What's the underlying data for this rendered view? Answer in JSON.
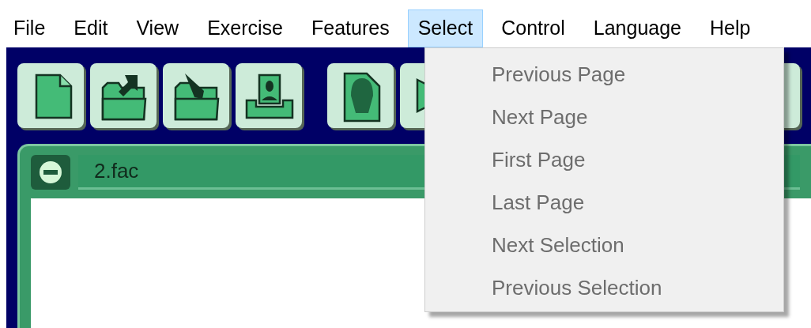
{
  "menu_bar": [
    {
      "label": "File",
      "selected": false
    },
    {
      "label": "Edit",
      "selected": false
    },
    {
      "label": "View",
      "selected": false
    },
    {
      "label": "Exercise",
      "selected": false
    },
    {
      "label": "Features",
      "selected": false
    },
    {
      "label": "Select",
      "selected": true
    },
    {
      "label": "Control",
      "selected": false
    },
    {
      "label": "Language",
      "selected": false
    },
    {
      "label": "Help",
      "selected": false
    }
  ],
  "toolbar": [
    {
      "kind": "new"
    },
    {
      "kind": "open"
    },
    {
      "kind": "import"
    },
    {
      "kind": "tray"
    },
    {
      "kind": "gap"
    },
    {
      "kind": "face"
    },
    {
      "kind": "play"
    }
  ],
  "document": {
    "title": "2.fac"
  },
  "dropdown": {
    "items": [
      {
        "label": "Previous Page",
        "disabled": true
      },
      {
        "label": "Next Page",
        "disabled": true
      },
      {
        "label": "First Page",
        "disabled": true
      },
      {
        "label": "Last Page",
        "disabled": true
      },
      {
        "label": "Next Selection",
        "disabled": true
      },
      {
        "label": "Previous Selection",
        "disabled": true
      }
    ]
  }
}
